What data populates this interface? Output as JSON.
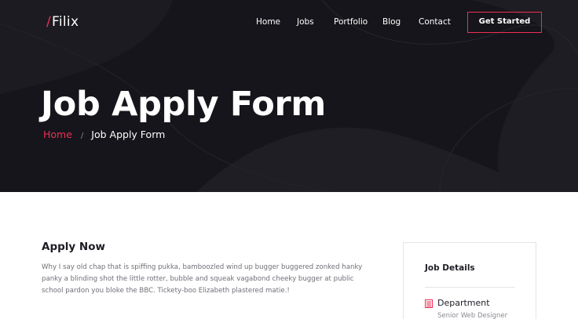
{
  "header": {
    "logo_slash": "/",
    "logo_text": "Filix",
    "nav": [
      "Home",
      "Jobs",
      "Portfolio",
      "Blog",
      "Contact"
    ],
    "cta_label": "Get Started"
  },
  "hero": {
    "title": "Job Apply Form",
    "breadcrumb": {
      "home": "Home",
      "separator": "/",
      "current": "Job Apply Form"
    }
  },
  "apply": {
    "title": "Apply Now",
    "text": "Why I say old chap that is spiffing pukka, bamboozled wind up bugger buggered zonked hanky panky a blinding shot the little rotter, bubble and squeak vagabond cheeky bugger at public school pardon you bloke the BBC. Tickety-boo Elizabeth plastered matie.!"
  },
  "job_details": {
    "title": "Job Details",
    "department_icon": "building-icon",
    "department_label": "Department",
    "department_value": "Senior Web Designer"
  },
  "colors": {
    "accent": "#ef2f55",
    "hero_bg": "#15151b"
  }
}
